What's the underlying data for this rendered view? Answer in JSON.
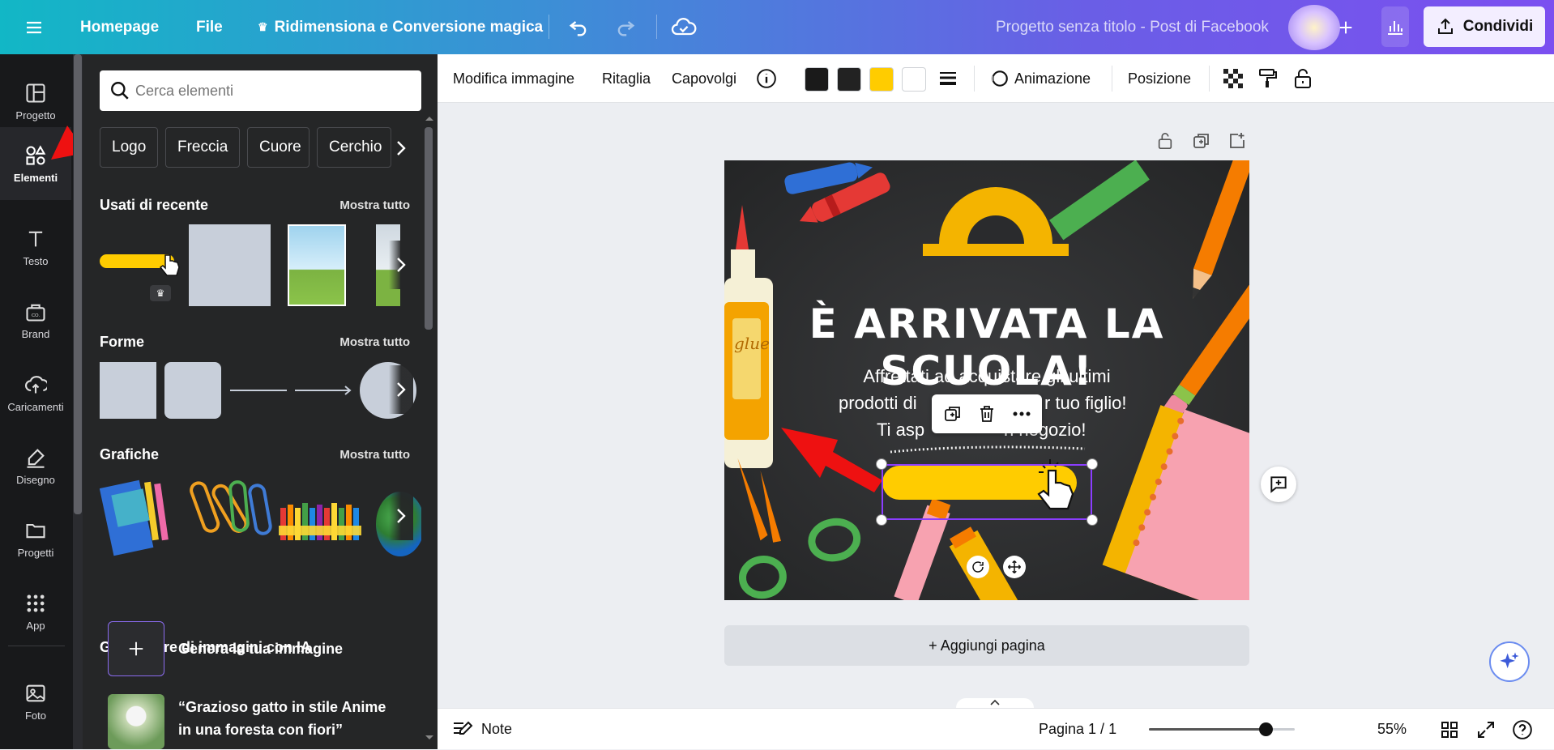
{
  "topbar": {
    "menu_icon": "hamburger-icon",
    "homepage": "Homepage",
    "file": "File",
    "magic_resize": "Ridimensiona e Conversione magica",
    "project_title": "Progetto senza titolo - Post di Facebook",
    "share": "Condividi"
  },
  "sidebar": {
    "items": [
      {
        "label": "Progetto",
        "icon": "layout-icon"
      },
      {
        "label": "Elementi",
        "icon": "shapes-icon",
        "active": true
      },
      {
        "label": "Testo",
        "icon": "text-icon"
      },
      {
        "label": "Brand",
        "icon": "brand-kit-icon"
      },
      {
        "label": "Caricamenti",
        "icon": "cloud-upload-icon"
      },
      {
        "label": "Disegno",
        "icon": "pen-icon"
      },
      {
        "label": "Progetti",
        "icon": "folder-icon"
      },
      {
        "label": "App",
        "icon": "apps-grid-icon"
      },
      {
        "label": "Foto",
        "icon": "photo-icon"
      }
    ]
  },
  "panel": {
    "search_placeholder": "Cerca elementi",
    "chips": [
      "Logo",
      "Freccia",
      "Cuore",
      "Cerchio"
    ],
    "recent": {
      "title": "Usati di recente",
      "show_all": "Mostra tutto"
    },
    "shapes": {
      "title": "Forme",
      "show_all": "Mostra tutto"
    },
    "graphics": {
      "title": "Grafiche",
      "show_all": "Mostra tutto"
    },
    "ai_generator": {
      "title": "Generatore di immagini con IA",
      "generate": "Genera la tua immagine",
      "example_line1": "“Grazioso gatto in stile Anime",
      "example_line2": "in una foresta con fiori”"
    }
  },
  "toolbar": {
    "edit_image": "Modifica immagine",
    "crop": "Ritaglia",
    "flip": "Capovolgi",
    "animation": "Animazione",
    "position": "Posizione",
    "swatches": [
      "#1a1a1a",
      "#222222",
      "#ffcc00",
      "#ffffff"
    ]
  },
  "design": {
    "title": "È ARRIVATA LA SCUOLA!",
    "subtitle_line1": "Affrettati ad acquistare gli ultimi",
    "subtitle_line2": "prodotti di",
    "subtitle_line2_end": "r tuo figlio!",
    "subtitle_line3": "Ti asp",
    "subtitle_line3_end": "n negozio!",
    "glue_label": "glue"
  },
  "canvas": {
    "add_page": "+ Aggiungi pagina"
  },
  "bottombar": {
    "notes": "Note",
    "page": "Pagina 1 / 1",
    "zoom": "55%",
    "zoom_fraction": 0.8
  },
  "colors": {
    "accent": "#8b3dff",
    "yellow": "#ffcc00",
    "chalkboard": "#2d2e30"
  }
}
